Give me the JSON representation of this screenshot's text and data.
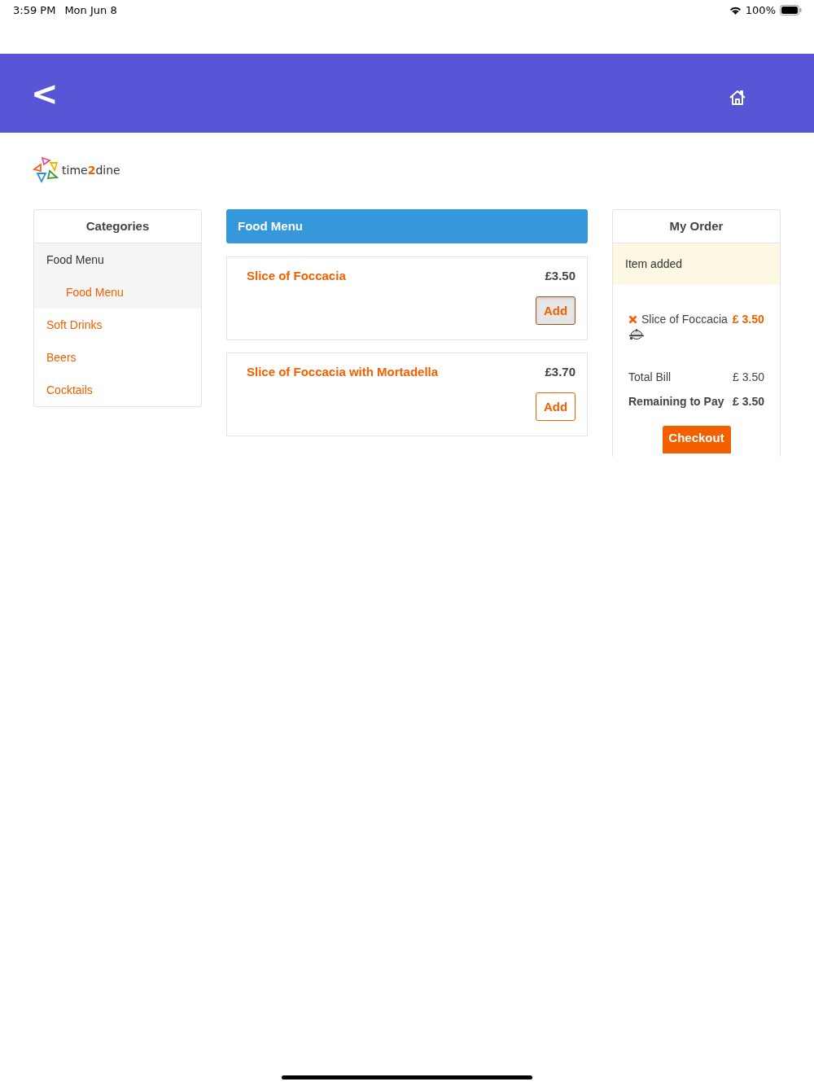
{
  "status_bar": {
    "time": "3:59 PM",
    "date": "Mon Jun 8",
    "battery": "100%"
  },
  "header": {
    "back": "<"
  },
  "logo": {
    "prefix": "time",
    "digit": "2",
    "suffix": "dine"
  },
  "categories": {
    "title": "Categories",
    "items": [
      {
        "label": "Food Menu",
        "selected": true,
        "children": [
          {
            "label": "Food Menu",
            "selected": true
          }
        ]
      },
      {
        "label": "Soft Drinks",
        "selected": false
      },
      {
        "label": "Beers",
        "selected": false
      },
      {
        "label": "Cocktails",
        "selected": false
      }
    ]
  },
  "menu": {
    "title": "Food Menu",
    "items": [
      {
        "name": "Slice of Foccacia",
        "price": "£3.50",
        "button": "Add",
        "pressed": true
      },
      {
        "name": "Slice of Foccacia with Mortadella",
        "price": "£3.70",
        "button": "Add",
        "pressed": false
      }
    ]
  },
  "order": {
    "title": "My Order",
    "notice": "Item added",
    "lines": [
      {
        "name": "Slice of Foccacia",
        "price": "£ 3.50"
      }
    ],
    "totals": [
      {
        "label": "Total Bill",
        "value": "£ 3.50",
        "bold": false
      },
      {
        "label": "Remaining to Pay",
        "value": "£ 3.50",
        "bold": true
      }
    ],
    "checkout": "Checkout"
  }
}
